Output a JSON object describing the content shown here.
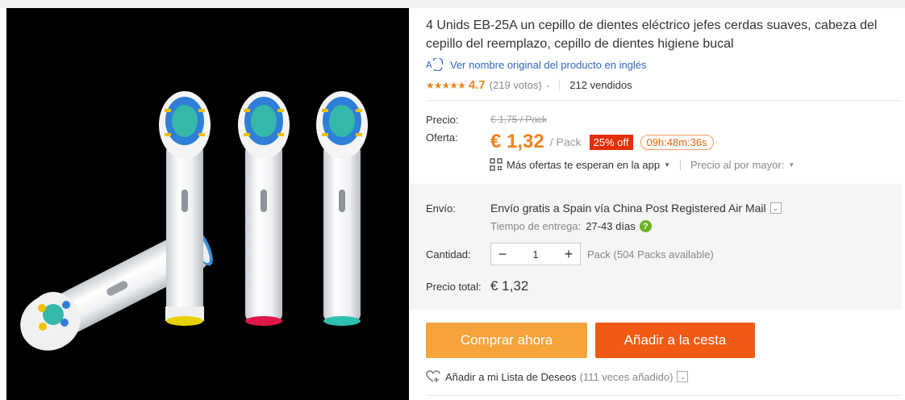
{
  "product": {
    "title": "4 Unids EB-25A un cepillo de dientes eléctrico jefes cerdas suaves, cabeza del cepillo del reemplazo, cepillo de dientes higiene bucal",
    "translate_link": "Ver nombre original del producto en inglés",
    "rating": "4.7",
    "votes": "(219 votos)",
    "sold": "212 vendidos"
  },
  "pricing": {
    "price_label": "Precio:",
    "old_price": "€ 1,75 / Pack",
    "offer_label": "Oferta:",
    "offer_price": "€ 1,32",
    "per_unit": "/ Pack",
    "discount": "25% off",
    "countdown": "09h:48m:36s",
    "app_offers": "Más ofertas te esperan en la app",
    "wholesale": "Precio al por mayor:"
  },
  "shipping": {
    "label": "Envío:",
    "method": "Envío gratis a Spain vía China Post Registered Air Mail",
    "delivery_label": "Tiempo de entrega:",
    "delivery_days": "27-43 días",
    "help": "?"
  },
  "quantity": {
    "label": "Cantidad:",
    "value": "1",
    "minus": "−",
    "plus": "+",
    "availability": "Pack (504 Packs available)"
  },
  "total": {
    "label": "Precio total:",
    "value": "€ 1,32"
  },
  "actions": {
    "buy_now": "Comprar ahora",
    "add_to_cart": "Añadir a la cesta",
    "wishlist": "Añadir a mi Lista de Deseos",
    "wishlist_count": "(111 veces añadido)"
  },
  "icons": {
    "translate": "translate-icon",
    "qr": "qr-code-icon",
    "heart": "heart-outline-icon",
    "star": "star-icon"
  },
  "colors": {
    "accent_orange": "#f1821d",
    "buy_button": "#f6a33b",
    "cart_button": "#f05a14",
    "discount_badge": "#e62e04",
    "link_blue": "#2f67c2"
  }
}
